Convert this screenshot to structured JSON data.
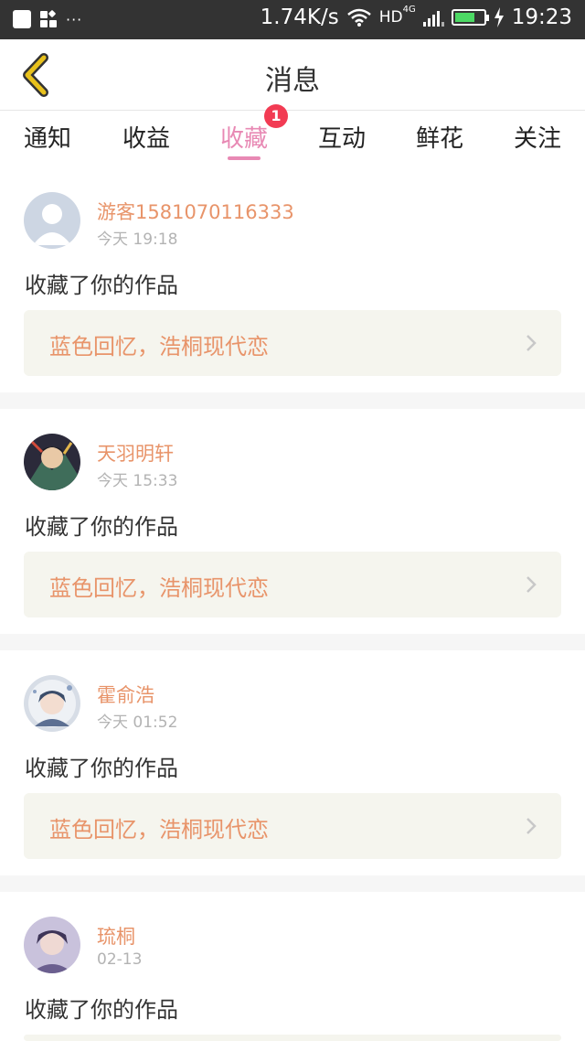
{
  "status_bar": {
    "speed": "1.74K/s",
    "network": "HD",
    "network_gen": "4G",
    "time": "19:23",
    "dots": "···",
    "icons": [
      "notification-square-icon",
      "app-grid-icon",
      "wifi-icon",
      "signal-icon",
      "battery-icon",
      "charging-icon"
    ]
  },
  "header": {
    "title": "消息",
    "back_icon": "chevron-left-icon",
    "accent_color": "#e8c11c"
  },
  "tabs": [
    {
      "label": "通知",
      "active": false
    },
    {
      "label": "收益",
      "active": false
    },
    {
      "label": "收藏",
      "active": true,
      "badge": "1"
    },
    {
      "label": "互动",
      "active": false
    },
    {
      "label": "鲜花",
      "active": false
    },
    {
      "label": "关注",
      "active": false
    }
  ],
  "colors": {
    "active_tab": "#e889b4",
    "username": "#e8946a",
    "badge": "#f23b53",
    "work_bg": "#f5f5ee"
  },
  "messages": [
    {
      "user": "游客1581070116333",
      "time": "今天 19:18",
      "action": "收藏了你的作品",
      "work": "蓝色回忆，浩桐现代恋"
    },
    {
      "user": "天羽明轩",
      "time": "今天 15:33",
      "action": "收藏了你的作品",
      "work": "蓝色回忆，浩桐现代恋"
    },
    {
      "user": "霍俞浩",
      "time": "今天 01:52",
      "action": "收藏了你的作品",
      "work": "蓝色回忆，浩桐现代恋"
    },
    {
      "user": "琉桐",
      "time": "02-13",
      "action": "收藏了你的作品",
      "work": ""
    }
  ]
}
